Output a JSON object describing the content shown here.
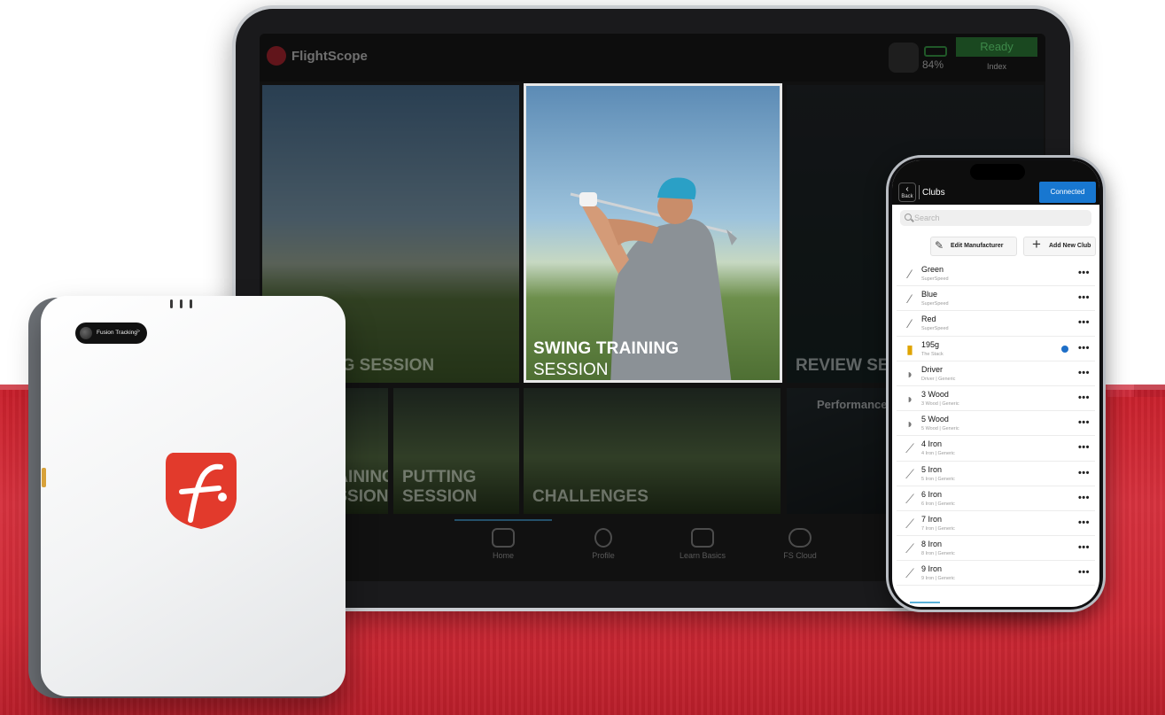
{
  "tablet": {
    "brand": "FlightScope",
    "battery_percent": "84%",
    "status": "Ready",
    "status_sub": "Index",
    "tiles": {
      "swing_left": "SWING SESSION",
      "review": "REVIEW SESSION",
      "training_left": "TRAINING SESSION",
      "putting": "PUTTING SESSION",
      "challenges": "CHALLENGES",
      "performance": "Performance",
      "featured_line1": "SWING TRAINING",
      "featured_line2": "SESSION"
    },
    "nav": [
      "Home",
      "Profile",
      "Learn Basics",
      "FS Cloud"
    ]
  },
  "phone": {
    "back_label": "Back",
    "title": "Clubs",
    "connected_label": "Connected",
    "search_placeholder": "Search",
    "edit_manufacturer": "Edit Manufacturer",
    "add_new_club": "Add New Club",
    "clubs": [
      {
        "name": "Green",
        "sub": "SuperSpeed",
        "icon": "speed-stick-icon",
        "selected": false
      },
      {
        "name": "Blue",
        "sub": "SuperSpeed",
        "icon": "speed-stick-icon",
        "selected": false
      },
      {
        "name": "Red",
        "sub": "SuperSpeed",
        "icon": "speed-stick-icon",
        "selected": false
      },
      {
        "name": "195g",
        "sub": "The Stack",
        "icon": "weight-icon",
        "selected": true
      },
      {
        "name": "Driver",
        "sub": "Driver | Generic",
        "icon": "wood-icon",
        "selected": false
      },
      {
        "name": "3 Wood",
        "sub": "3 Wood | Generic",
        "icon": "wood-icon",
        "selected": false
      },
      {
        "name": "5 Wood",
        "sub": "5 Wood | Generic",
        "icon": "wood-icon",
        "selected": false
      },
      {
        "name": "4 Iron",
        "sub": "4 Iron | Generic",
        "icon": "iron-icon",
        "selected": false
      },
      {
        "name": "5 Iron",
        "sub": "5 Iron | Generic",
        "icon": "iron-icon",
        "selected": false
      },
      {
        "name": "6 Iron",
        "sub": "6 Iron | Generic",
        "icon": "iron-icon",
        "selected": false
      },
      {
        "name": "7 Iron",
        "sub": "7 Iron | Generic",
        "icon": "iron-icon",
        "selected": false
      },
      {
        "name": "8 Iron",
        "sub": "8 Iron | Generic",
        "icon": "iron-icon",
        "selected": false
      },
      {
        "name": "9 Iron",
        "sub": "9 Iron | Generic",
        "icon": "iron-icon",
        "selected": false
      }
    ],
    "more_glyph": "•••"
  },
  "device": {
    "badge_label": "Fusion Tracking",
    "badge_arrow": ">"
  },
  "colors": {
    "brand_red": "#c8202c",
    "connected_blue": "#1877d0",
    "ready_green": "#4db15d"
  }
}
